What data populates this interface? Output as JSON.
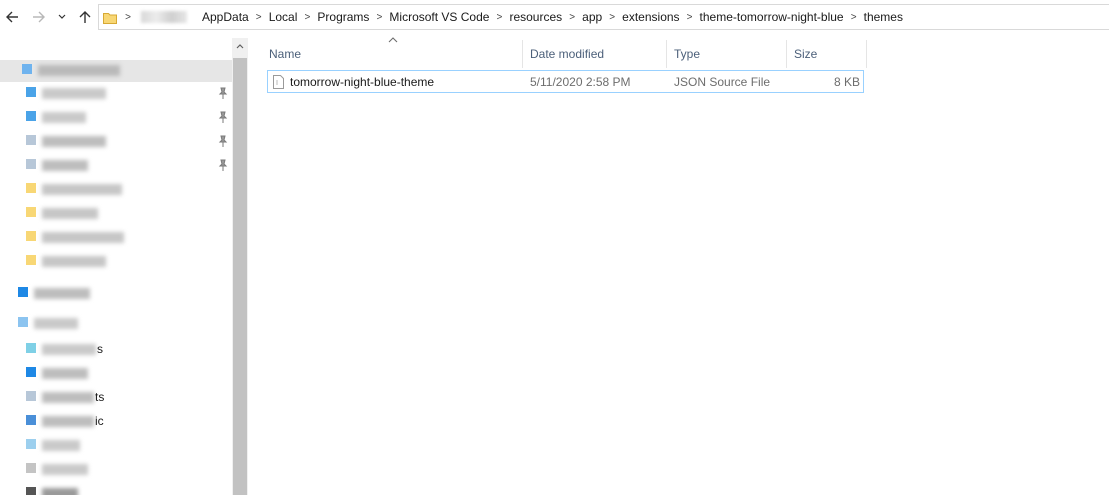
{
  "address": {
    "crumbs": [
      "AppData",
      "Local",
      "Programs",
      "Microsoft VS Code",
      "resources",
      "app",
      "extensions",
      "theme-tomorrow-night-blue",
      "themes"
    ],
    "separator": ">"
  },
  "columns": {
    "name": "Name",
    "date": "Date modified",
    "type": "Type",
    "size": "Size"
  },
  "files": [
    {
      "name": "tomorrow-night-blue-theme",
      "date": "5/11/2020 2:58 PM",
      "type": "JSON Source File",
      "size": "8 KB"
    }
  ],
  "nav_tails": [
    "s",
    "ts",
    "ic"
  ],
  "icons": {
    "back": "arrow-left-icon",
    "forward": "arrow-right-icon",
    "recent": "chevron-down-icon",
    "up": "arrow-up-icon",
    "folder": "folder-icon",
    "pin": "pin-icon",
    "file": "json-file-icon"
  },
  "colors": {
    "folder_yellow": "#f8d775",
    "selection_border": "#99d1ff",
    "header_text": "#4c607a",
    "accent_blue": "#1e88e5"
  }
}
